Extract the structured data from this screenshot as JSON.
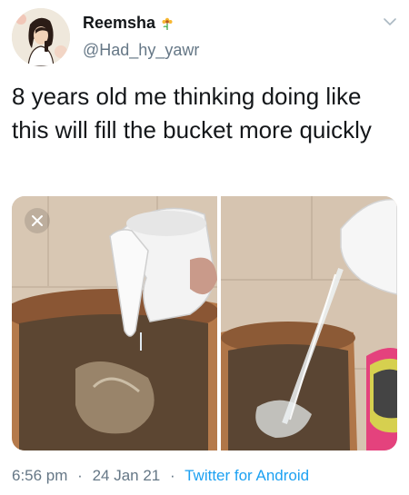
{
  "tweet": {
    "display_name": "Reemsha",
    "name_emoji_icon": "sunflower-icon",
    "handle": "@Had_hy_yawr",
    "text": "8 years old me thinking doing like this will fill the bucket more quickly",
    "time": "6:56 pm",
    "separator": "·",
    "date": "24 Jan 21",
    "source": "Twitter for Android"
  },
  "media": {
    "photos": [
      {
        "description_icon": "photo-jug-pouring-small-stream"
      },
      {
        "description_icon": "photo-jug-pouring-large-stream"
      }
    ]
  },
  "colors": {
    "text": "#14171a",
    "secondary": "#657786",
    "link": "#1da1f2"
  }
}
